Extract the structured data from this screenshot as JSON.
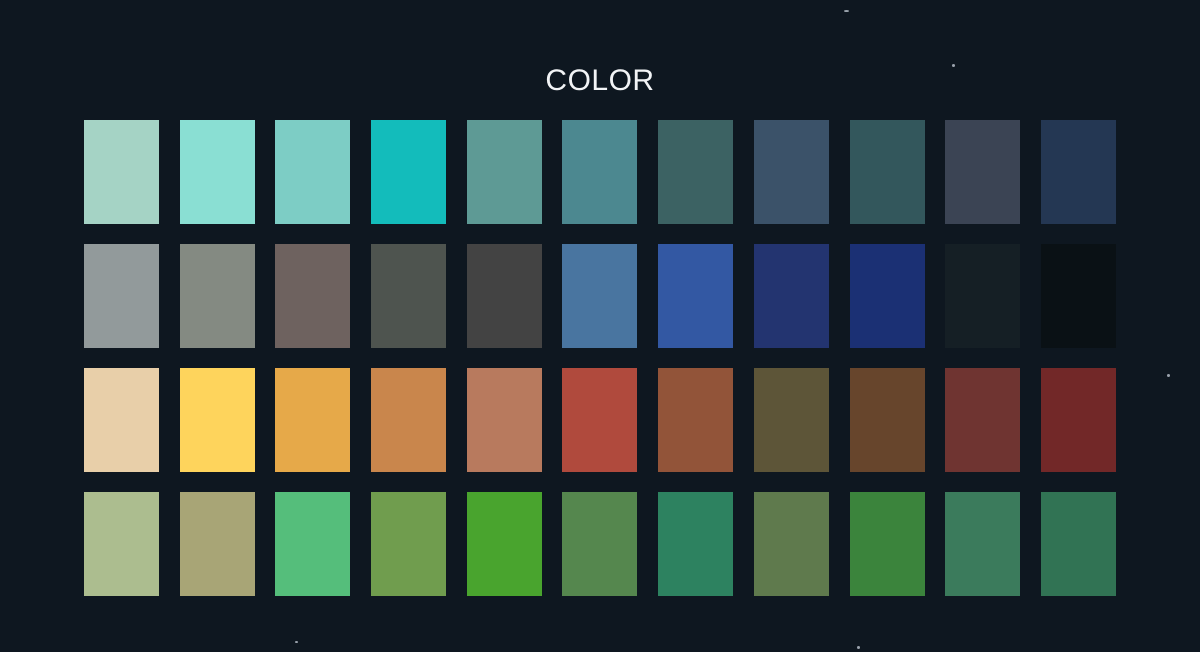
{
  "title": "COLOR",
  "palette": {
    "rows": [
      [
        "#a5d3c5",
        "#8adfd3",
        "#7dcdc5",
        "#13bcbb",
        "#5e9a95",
        "#4c8890",
        "#3c6263",
        "#3b5269",
        "#33575c",
        "#3b4454",
        "#243753"
      ],
      [
        "#929a9b",
        "#848a82",
        "#6e625f",
        "#4e544f",
        "#434343",
        "#4975a0",
        "#3358a3",
        "#233470",
        "#1b3074",
        "#151f25",
        "#0a1115"
      ],
      [
        "#e8cfa9",
        "#fed45c",
        "#e6a949",
        "#c9864c",
        "#b87a5e",
        "#b04a3d",
        "#925439",
        "#5d5538",
        "#67452c",
        "#6f3431",
        "#722828"
      ],
      [
        "#acbd8f",
        "#a8a576",
        "#55be7b",
        "#709d4e",
        "#49a42e",
        "#55874e",
        "#2d8260",
        "#5f7a4d",
        "#3b843c",
        "#3b7b5c",
        "#317354"
      ]
    ]
  }
}
